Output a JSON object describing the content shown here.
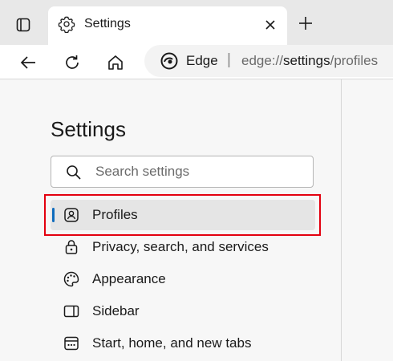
{
  "tab": {
    "title": "Settings",
    "icon": "gear-icon"
  },
  "address_bar": {
    "site_label": "Edge",
    "separator": "|",
    "url_prefix": "edge://",
    "url_path": "settings",
    "url_suffix": "/profiles"
  },
  "sidebar": {
    "title": "Settings",
    "search": {
      "placeholder": "Search settings"
    },
    "items": [
      {
        "label": "Profiles",
        "icon": "profile-icon",
        "selected": true
      },
      {
        "label": "Privacy, search, and services",
        "icon": "lock-icon"
      },
      {
        "label": "Appearance",
        "icon": "palette-icon"
      },
      {
        "label": "Sidebar",
        "icon": "sidebar-icon"
      },
      {
        "label": "Start, home, and new tabs",
        "icon": "start-home-icon"
      }
    ]
  },
  "colors": {
    "accent": "#0f6cbd",
    "highlight": "#e3000f",
    "selected_bg": "#e5e5e5"
  }
}
